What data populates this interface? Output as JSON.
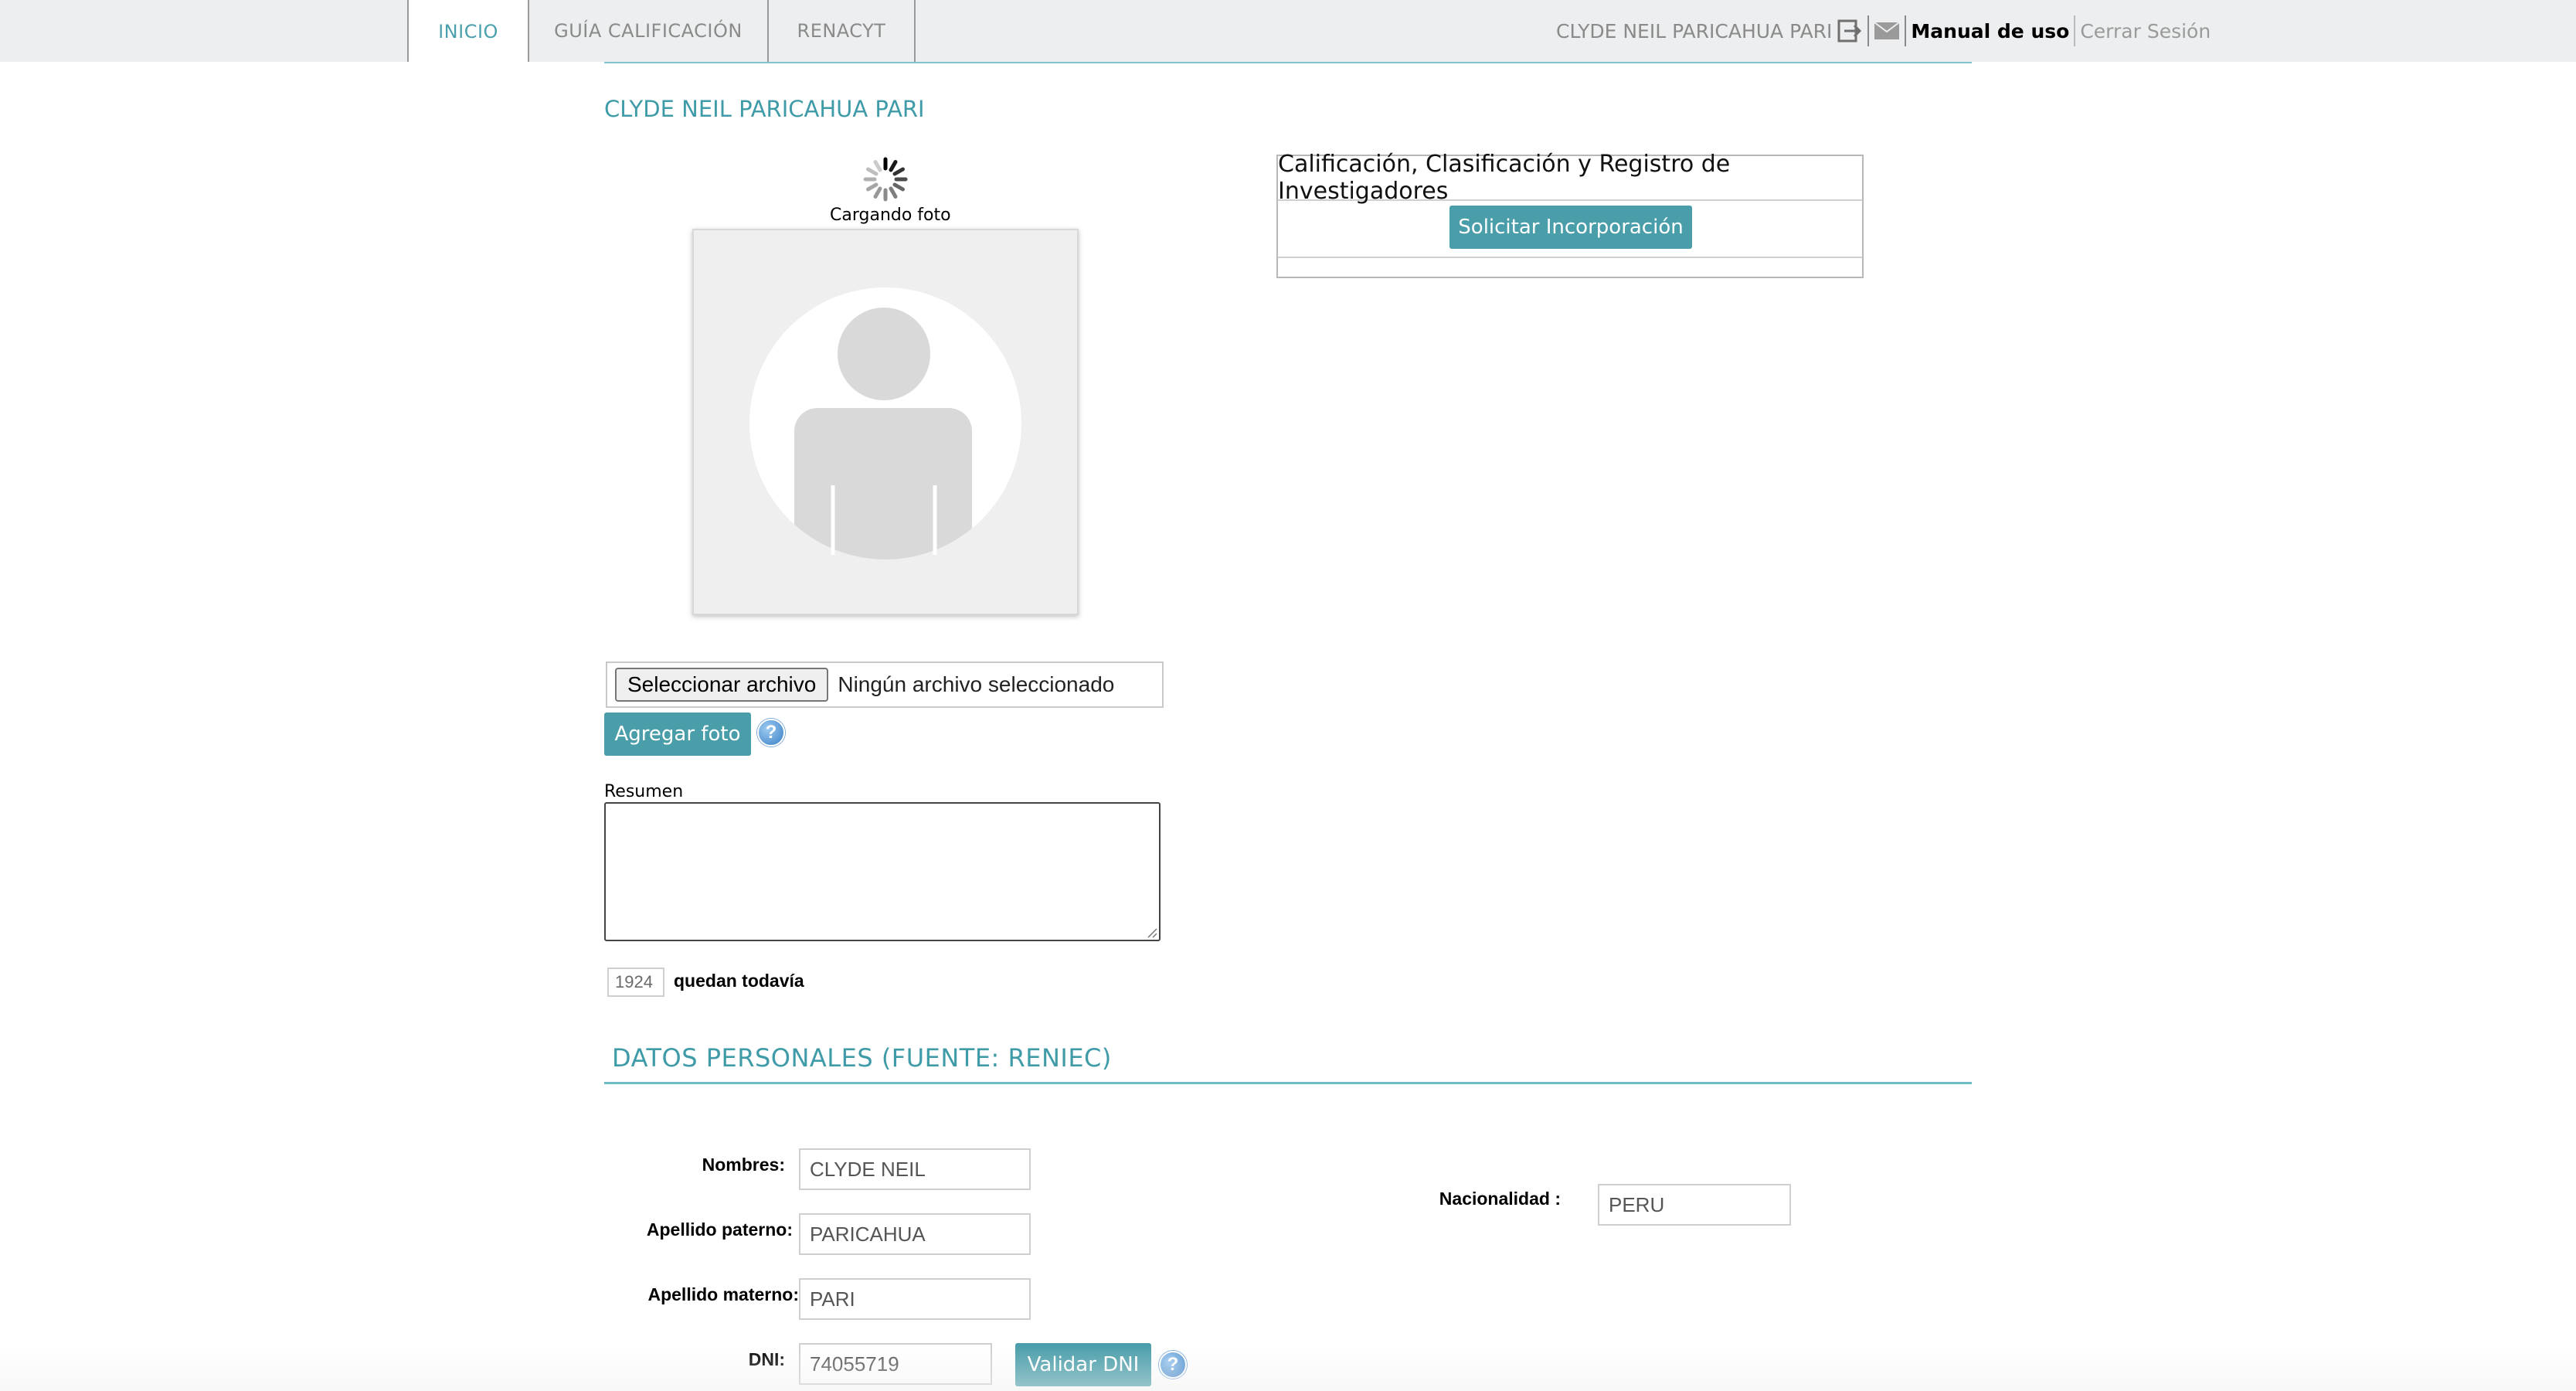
{
  "nav": {
    "tabs": [
      {
        "label": "INICIO",
        "active": true
      },
      {
        "label": "GUÍA CALIFICACIÓN",
        "active": false
      },
      {
        "label": "RENACYT",
        "active": false
      }
    ],
    "user_name": "CLYDE NEIL PARICAHUA PARI",
    "manual_label": "Manual de uso",
    "logout_label": "Cerrar Sesión",
    "icons": [
      "exit-icon",
      "mail-icon"
    ]
  },
  "profile": {
    "title": "CLYDE NEIL PARICAHUA PARI",
    "loading_text": "Cargando foto",
    "file_button_label": "Seleccionar archivo",
    "file_status": "Ningún archivo seleccionado",
    "add_photo_label": "Agregar foto",
    "summary_label": "Resumen",
    "summary_value": "",
    "chars_remaining": "1924",
    "chars_remaining_label": "quedan todavía"
  },
  "ccr_panel": {
    "title": "Calificación, Clasificación y Registro de Investigadores",
    "button_label": "Solicitar Incorporación"
  },
  "personal_data": {
    "section_title": "DATOS PERSONALES  (FUENTE: RENIEC)",
    "nombres_label": "Nombres:",
    "nombres_value": "CLYDE NEIL",
    "apellido_paterno_label": "Apellido paterno:",
    "apellido_paterno_value": "PARICAHUA",
    "apellido_materno_label": "Apellido materno:",
    "apellido_materno_value": "PARI",
    "dni_label": "DNI:",
    "dni_value": "74055719",
    "validar_dni_label": "Validar DNI",
    "nacionalidad_label": "Nacionalidad :",
    "nacionalidad_value": "PERU"
  },
  "colors": {
    "accent": "#4a9eaa",
    "topbar_bg": "#eceeef",
    "title_teal": "#3f9ba8"
  }
}
